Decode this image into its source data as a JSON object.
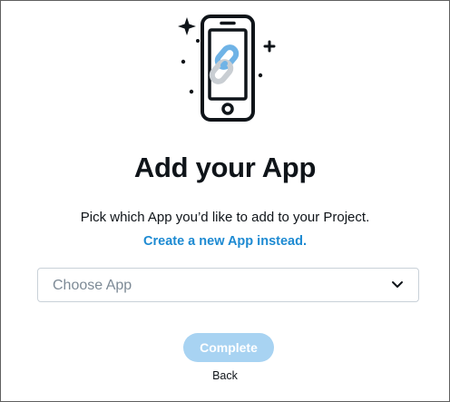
{
  "dialog": {
    "title": "Add your App",
    "subtitle": "Pick which App you’d like to add to your Project.",
    "create_link": "Create a new App instead.",
    "select": {
      "placeholder": "Choose App",
      "icon": "chevron-down-icon"
    },
    "complete_label": "Complete",
    "back_label": "Back",
    "illustration_icon": "phone-link-icon"
  },
  "colors": {
    "link": "#1d8ad2",
    "button_disabled": "#a8d3f2",
    "text": "#0f1419",
    "placeholder": "#7d8a96",
    "link_chain_blue": "#6fb3e6",
    "link_chain_grey": "#c9ced3"
  }
}
